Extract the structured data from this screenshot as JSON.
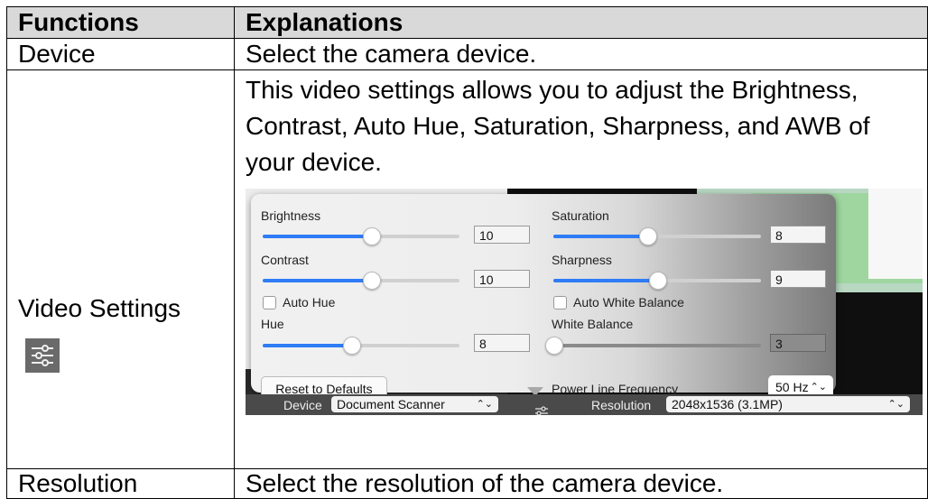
{
  "table": {
    "header": {
      "functions": "Functions",
      "explanations": "Explanations"
    },
    "rows": [
      {
        "function": "Device",
        "explanation": "Select the camera device."
      },
      {
        "function": "Video Settings",
        "explanation": "This video settings allows you to adjust the Brightness, Contrast, Auto Hue, Saturation, Sharpness, and AWB of your device."
      },
      {
        "function": "Resolution",
        "explanation": "Select the resolution of the camera device."
      }
    ]
  },
  "screenshot": {
    "brightness": {
      "label": "Brightness",
      "value": "10",
      "level": 0.55
    },
    "contrast": {
      "label": "Contrast",
      "value": "10",
      "level": 0.55
    },
    "auto_hue": {
      "label": "Auto Hue",
      "checked": false
    },
    "hue": {
      "label": "Hue",
      "value": "8",
      "level": 0.45
    },
    "reset_button": "Reset to Defaults",
    "saturation": {
      "label": "Saturation",
      "value": "8",
      "level": 0.45
    },
    "sharpness": {
      "label": "Sharpness",
      "value": "9",
      "level": 0.5
    },
    "auto_white_balance": {
      "label": "Auto White Balance",
      "checked": false
    },
    "white_balance": {
      "label": "White Balance",
      "value": "3",
      "level": 0.0
    },
    "power_line_frequency": {
      "label": "Power Line Frequency",
      "value": "50 Hz"
    },
    "bottom_bar": {
      "device_label": "Device",
      "device_value": "Document Scanner",
      "resolution_label": "Resolution",
      "resolution_value": "2048x1536 (3.1MP)"
    }
  },
  "colors": {
    "accent": "#2f7cf6",
    "header_bg": "#d9d9d9"
  },
  "icons": {
    "video_settings": "sliders-icon",
    "chevron": "chevron-updown-icon"
  }
}
